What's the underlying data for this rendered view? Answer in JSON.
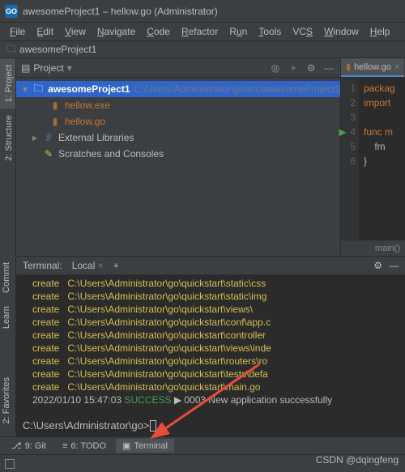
{
  "title": "awesomeProject1 – hellow.go (Administrator)",
  "app_icon": "GO",
  "menu": [
    "File",
    "Edit",
    "View",
    "Navigate",
    "Code",
    "Refactor",
    "Run",
    "Tools",
    "VCS",
    "Window",
    "Help"
  ],
  "nav_root": "awesomeProject1",
  "left_tabs": [
    "1: Project",
    "2: Structure",
    "Commit",
    "Learn",
    "2: Favorites"
  ],
  "project_panel": {
    "title": "Project",
    "root": {
      "name": "awesomeProject1",
      "path": "C:\\Users\\Administrator\\go\\src\\awesomeProject1"
    },
    "files": [
      "hellow.exe",
      "hellow.go"
    ],
    "external": "External Libraries",
    "scratches": "Scratches and Consoles"
  },
  "editor": {
    "tab": "hellow.go",
    "lines": [
      "1",
      "2",
      "3",
      "4",
      "5",
      "6"
    ],
    "code": {
      "l1": "packag",
      "l2": "import",
      "l3": "",
      "l4": "func m",
      "l5": "    fm",
      "l6": "}"
    },
    "breadcrumb": "main()"
  },
  "terminal": {
    "title": "Terminal:",
    "tab": "Local",
    "lines": [
      {
        "a": "create",
        "p": "C:\\Users\\Administrator\\go\\quickstart\\static\\css"
      },
      {
        "a": "create",
        "p": "C:\\Users\\Administrator\\go\\quickstart\\static\\img"
      },
      {
        "a": "create",
        "p": "C:\\Users\\Administrator\\go\\quickstart\\views\\"
      },
      {
        "a": "create",
        "p": "C:\\Users\\Administrator\\go\\quickstart\\conf\\app.c"
      },
      {
        "a": "create",
        "p": "C:\\Users\\Administrator\\go\\quickstart\\controller"
      },
      {
        "a": "create",
        "p": "C:\\Users\\Administrator\\go\\quickstart\\views\\inde"
      },
      {
        "a": "create",
        "p": "C:\\Users\\Administrator\\go\\quickstart\\routers\\ro"
      },
      {
        "a": "create",
        "p": "C:\\Users\\Administrator\\go\\quickstart\\tests\\defa"
      },
      {
        "a": "create",
        "p": "C:\\Users\\Administrator\\go\\quickstart\\main.go"
      }
    ],
    "status": {
      "ts": "2022/01/10 15:47:03",
      "label": "SUCCESS",
      "arrow": "▶",
      "code": "0003",
      "msg": "New application successfully"
    },
    "prompt": "C:\\Users\\Administrator\\go>"
  },
  "bottom_tabs": [
    {
      "icon": "⎇",
      "label": "9: Git"
    },
    {
      "icon": "≡",
      "label": "6: TODO"
    },
    {
      "icon": "▣",
      "label": "Terminal"
    }
  ],
  "watermark": "CSDN @dqingfeng"
}
